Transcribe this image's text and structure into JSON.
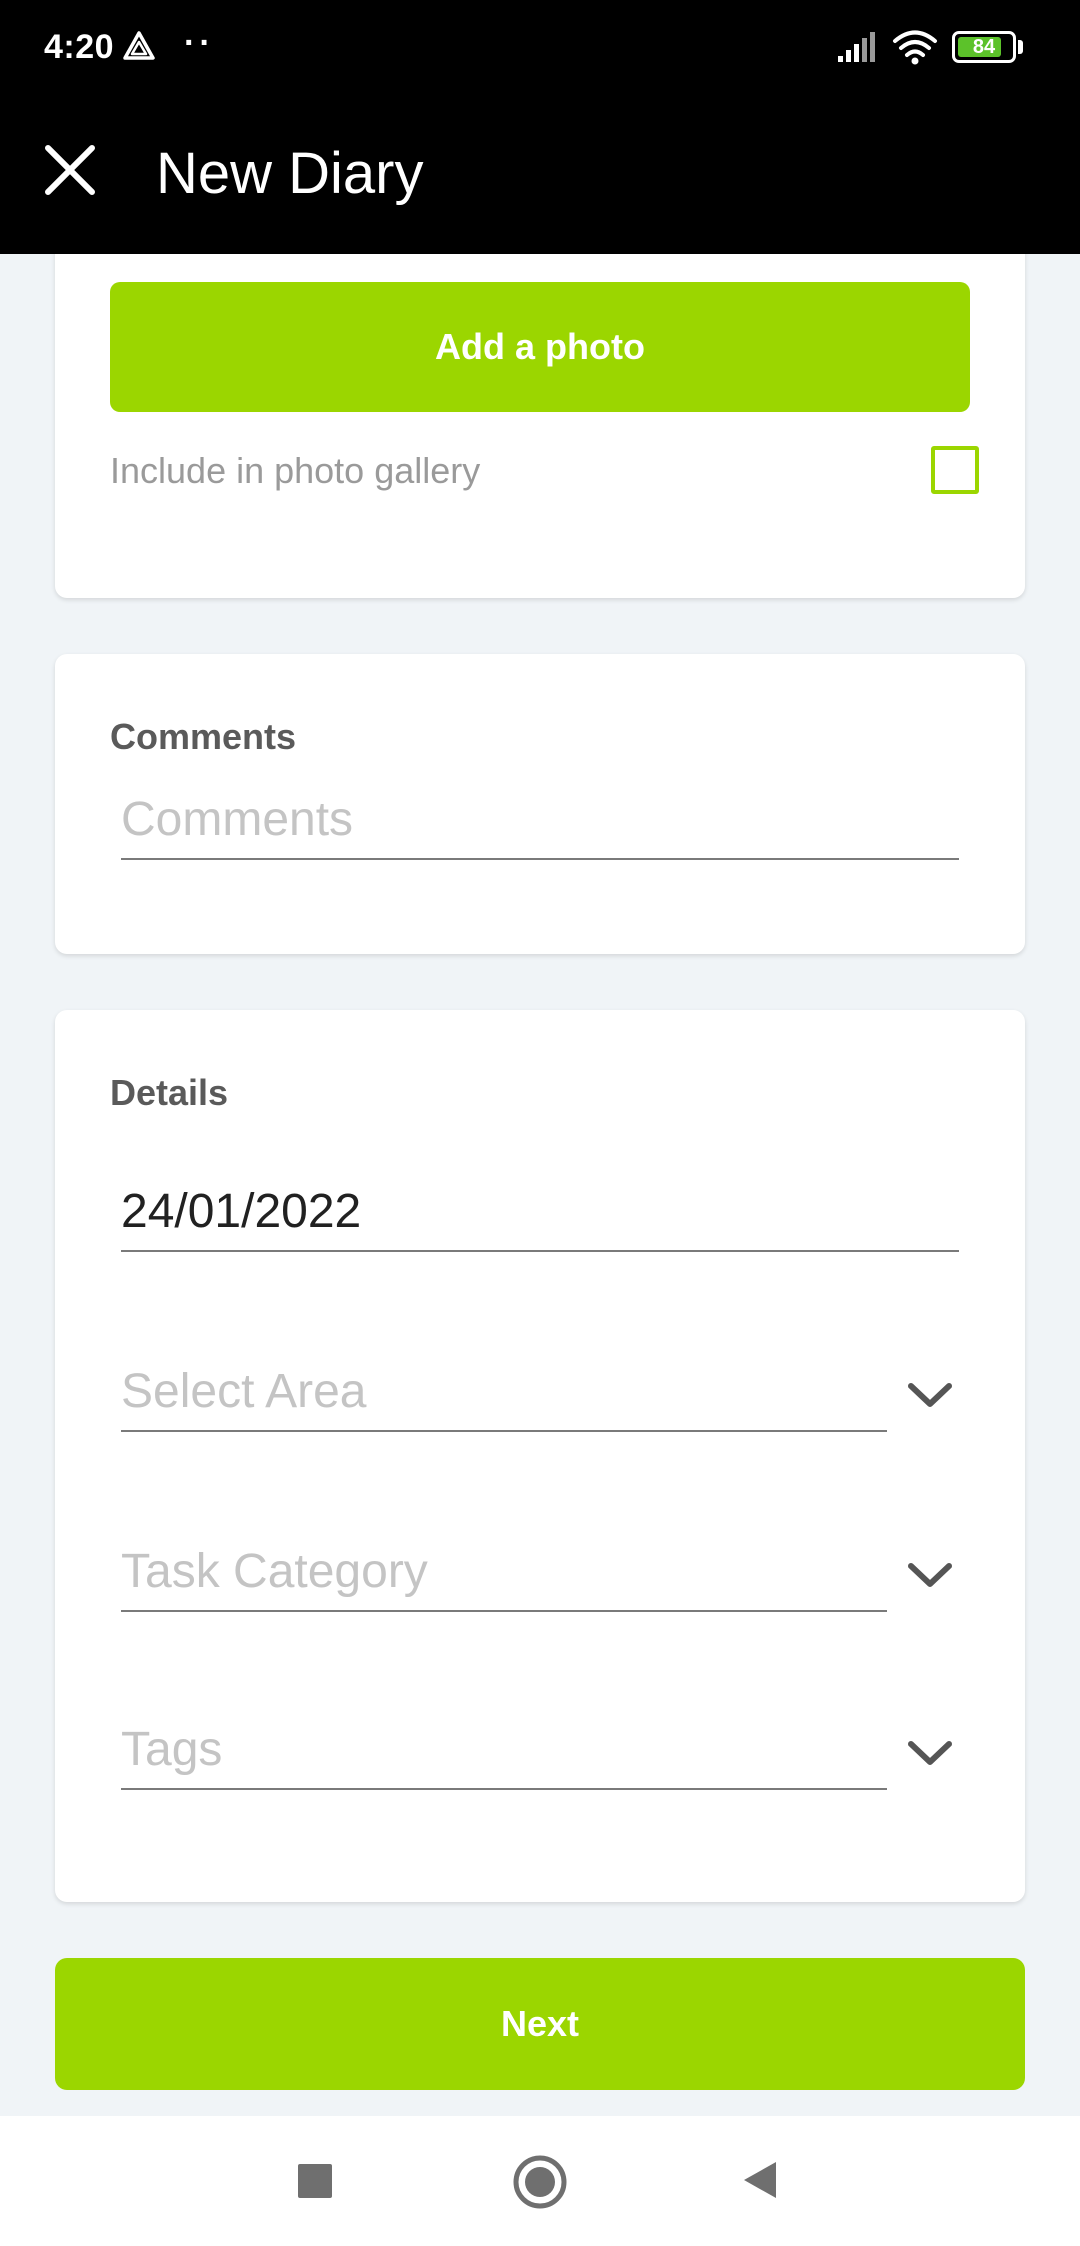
{
  "status_bar": {
    "time": "4:20",
    "dots": "··",
    "battery_level": "84",
    "battery_percent": 84,
    "icons": [
      "alert-triangle-icon",
      "signal-icon",
      "wifi-icon",
      "battery-icon"
    ]
  },
  "app_bar": {
    "title": "New Diary",
    "close_icon": "close-icon"
  },
  "photo_section": {
    "add_photo_label": "Add a photo",
    "include_gallery_label": "Include in photo gallery",
    "include_gallery_checked": false
  },
  "comments_section": {
    "heading": "Comments",
    "placeholder": "Comments",
    "value": ""
  },
  "details_section": {
    "heading": "Details",
    "date_value": "24/01/2022",
    "area_placeholder": "Select Area",
    "task_category_placeholder": "Task Category",
    "tags_placeholder": "Tags"
  },
  "footer": {
    "next_label": "Next"
  },
  "colors": {
    "accent": "#9bd600",
    "app_bar": "#000000",
    "background": "#f0f4f7"
  },
  "nav_bar": {
    "icons": [
      "recents-square-icon",
      "home-circle-icon",
      "back-triangle-icon"
    ]
  }
}
